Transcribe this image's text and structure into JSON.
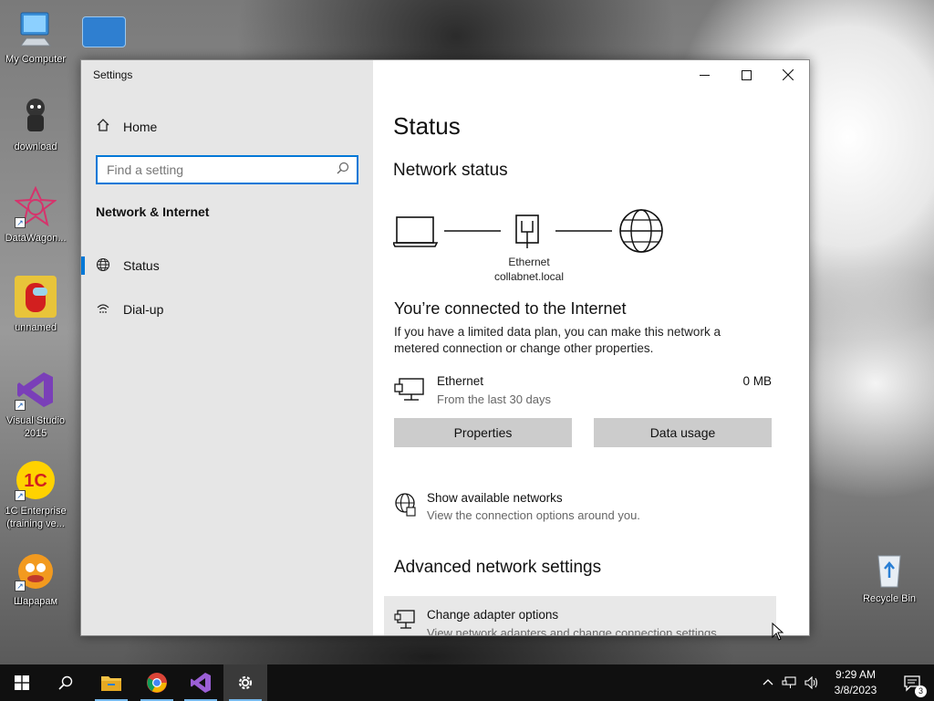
{
  "desktop": {
    "icons": [
      {
        "label": "My Computer"
      },
      {
        "label": "download"
      },
      {
        "label": "DataWagon..."
      },
      {
        "label": "unnamed"
      },
      {
        "label": "Visual Studio 2015"
      },
      {
        "label": "1C Enterprise (training ve..."
      },
      {
        "label": "Шарарам"
      },
      {
        "label": "Recycle Bin"
      }
    ]
  },
  "window": {
    "title": "Settings",
    "caption": {
      "minimize_icon": "minimize-icon",
      "maximize_icon": "maximize-icon",
      "close_icon": "close-icon"
    }
  },
  "sidebar": {
    "home_label": "Home",
    "search_placeholder": "Find a setting",
    "section_title": "Network & Internet",
    "items": [
      {
        "label": "Status",
        "icon": "globe-icon",
        "active": true
      },
      {
        "label": "Dial-up",
        "icon": "dialup-icon",
        "active": false
      }
    ]
  },
  "main": {
    "title": "Status",
    "network_status_heading": "Network status",
    "diagram": {
      "adapter_name": "Ethernet",
      "domain": "collabnet.local"
    },
    "connected_heading": "You’re connected to the Internet",
    "connected_text": "If you have a limited data plan, you can make this network a metered connection or change other properties.",
    "ethernet": {
      "name": "Ethernet",
      "period": "From the last 30 days",
      "usage": "0 MB"
    },
    "buttons": {
      "properties": "Properties",
      "data_usage": "Data usage"
    },
    "show_networks": {
      "title": "Show available networks",
      "subtitle": "View the connection options around you."
    },
    "advanced_heading": "Advanced network settings",
    "adapter_options": {
      "title": "Change adapter options",
      "subtitle": "View network adapters and change connection settings."
    }
  },
  "taskbar": {
    "apps": [
      "start-icon",
      "search-icon",
      "file-explorer-icon",
      "chrome-icon",
      "visual-studio-icon",
      "settings-icon"
    ],
    "clock": {
      "time": "9:29 AM",
      "date": "3/8/2023"
    },
    "notifications_count": "3"
  },
  "colors": {
    "accent": "#0078d7",
    "sidebar_bg": "#e6e6e6",
    "button_bg": "#cccccc",
    "taskbar_bg": "#101010"
  }
}
